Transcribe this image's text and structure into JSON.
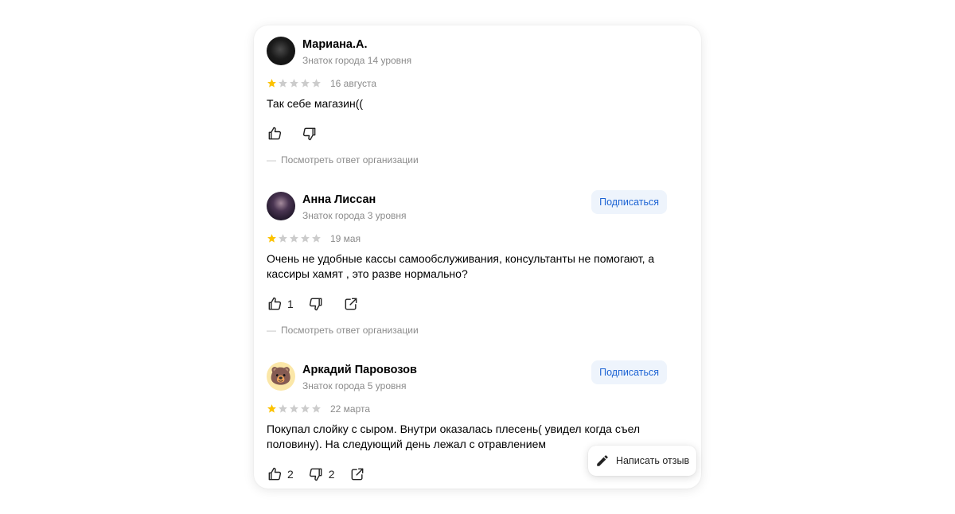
{
  "reviews": [
    {
      "name": "Мариана.А.",
      "level": "Знаток города 14 уровня",
      "rating": 1,
      "date": "16 августа",
      "text": "Так себе магазин((",
      "likes": "",
      "dislikes": "",
      "reply_link": "Посмотреть ответ организации"
    },
    {
      "name": "Анна Лиссан",
      "level": "Знаток города 3 уровня",
      "subscribe_label": "Подписаться",
      "rating": 1,
      "date": "19 мая",
      "text": "Очень не удобные кассы самообслуживания, консультанты не помогают, а кассиры хамят , это разве нормально?",
      "likes": "1",
      "dislikes": "",
      "reply_link": "Посмотреть ответ организации"
    },
    {
      "name": "Аркадий Паровозов",
      "level": "Знаток города 5 уровня",
      "subscribe_label": "Подписаться",
      "rating": 1,
      "date": "22 марта",
      "text": "Покупал слойку с сыром. Внутри оказалась плесень( увидел когда съел половину). На следующий день лежал с отравлением",
      "likes": "2",
      "dislikes": "2"
    }
  ],
  "reply_dash": "—",
  "write_review_label": "Написать отзыв",
  "colors": {
    "star_on": "#fcc200",
    "star_off": "#cccccc",
    "link_blue": "#1d64d4",
    "secondary_text": "#8b8b8b"
  },
  "icons": [
    "thumb-up-icon",
    "thumb-down-icon",
    "share-icon",
    "pencil-icon",
    "bear-emoji-avatar"
  ]
}
